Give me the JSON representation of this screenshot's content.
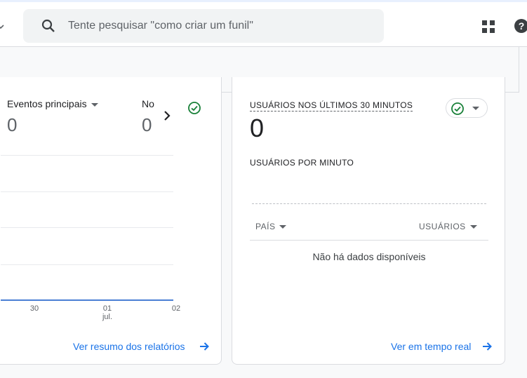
{
  "search": {
    "placeholder": "Tente pesquisar \"como criar um funil\""
  },
  "icons": {
    "search": "search-icon",
    "apps": "apps-grid-icon",
    "help": "help-icon",
    "next": "chevron-right-icon",
    "check": "check-circle-icon",
    "arrow": "arrow-right-icon"
  },
  "colors": {
    "link": "#1a73e8",
    "check": "#188038",
    "chart_line": "#4a7fd4"
  },
  "summary_card": {
    "metrics": [
      {
        "label": "Eventos principais",
        "value": "0"
      },
      {
        "label": "No",
        "value": "0"
      }
    ],
    "x_ticks": [
      {
        "day": "30",
        "month": ""
      },
      {
        "day": "01",
        "month": "jul."
      },
      {
        "day": "02",
        "month": ""
      }
    ],
    "link": "Ver resumo dos relatórios"
  },
  "realtime_card": {
    "title": "USUÁRIOS NOS ÚLTIMOS 30 MINUTOS",
    "value": "0",
    "subtitle": "USUÁRIOS POR MINUTO",
    "columns": [
      "PAÍS",
      "USUÁRIOS"
    ],
    "empty_text": "Não há dados disponíveis",
    "link": "Ver em tempo real"
  }
}
